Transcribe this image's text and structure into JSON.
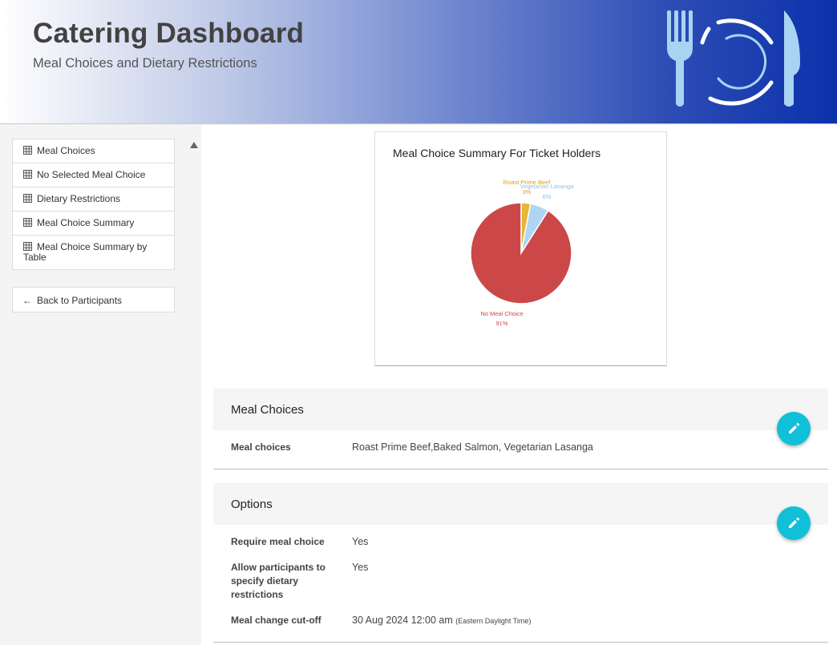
{
  "header": {
    "title": "Catering Dashboard",
    "subtitle": "Meal Choices and Dietary Restrictions",
    "logo_icon": "fork-plate-knife-icon"
  },
  "sidebar": {
    "items": [
      {
        "label": "Meal Choices",
        "icon": "table-icon"
      },
      {
        "label": "No Selected Meal Choice",
        "icon": "table-icon"
      },
      {
        "label": "Dietary Restrictions",
        "icon": "table-icon"
      },
      {
        "label": "Meal Choice Summary",
        "icon": "table-icon"
      },
      {
        "label": "Meal Choice Summary by Table",
        "icon": "table-icon"
      }
    ],
    "back_label": "Back to Participants"
  },
  "chart_data": {
    "type": "pie",
    "title": "Meal Choice Summary For Ticket Holders",
    "slices": [
      {
        "label": "Roast Prime Beef",
        "value": 3,
        "display": "3%",
        "color": "#e8b634"
      },
      {
        "label": "Vegetarian Lasanga",
        "value": 6,
        "display": "6%",
        "color": "#aed5f4"
      },
      {
        "label": "No Meal Choice",
        "value": 91,
        "display": "91%",
        "color": "#cc4848"
      }
    ]
  },
  "meal_panel": {
    "title": "Meal Choices",
    "rows": [
      {
        "label": "Meal choices",
        "value": "Roast Prime Beef,Baked Salmon, Vegetarian Lasanga"
      }
    ]
  },
  "options_panel": {
    "title": "Options",
    "require_label": "Require meal choice",
    "require_value": "Yes",
    "allow_label_1": "Allow participants to",
    "allow_label_2": "specify dietary",
    "allow_label_3": "restrictions",
    "allow_value": "Yes",
    "cutoff_label": "Meal change cut-off",
    "cutoff_value": "30 Aug 2024 12:00 am",
    "cutoff_tz": "(Eastern Daylight Time)"
  },
  "colors": {
    "accent": "#10c0d8",
    "header_dark": "#0b31ab"
  }
}
